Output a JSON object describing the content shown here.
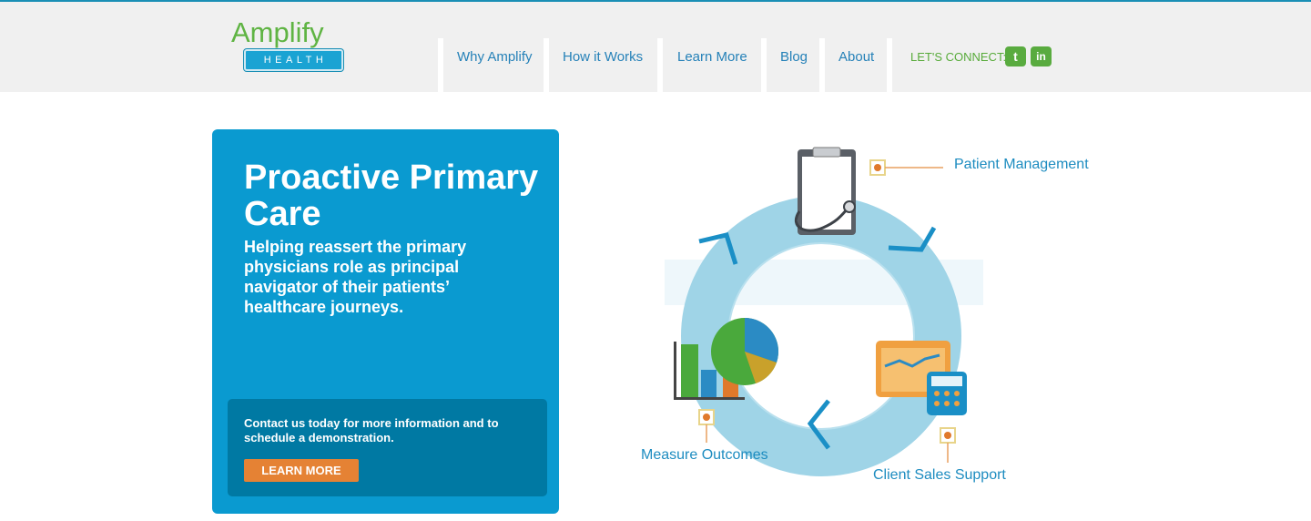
{
  "brand": {
    "name": "Amplify",
    "sub": "HEALTH"
  },
  "nav": {
    "items": [
      {
        "label": "Why Amplify"
      },
      {
        "label": "How it Works"
      },
      {
        "label": "Learn More"
      },
      {
        "label": "Blog"
      },
      {
        "label": "About"
      }
    ],
    "connect_label": "LET'S CONNECT:",
    "social": [
      {
        "name": "twitter-icon",
        "glyph": "t"
      },
      {
        "name": "linkedin-icon",
        "glyph": "in"
      }
    ]
  },
  "hero": {
    "title": "Proactive Primary Care",
    "subtitle": "Helping reassert the primary physicians role as principal navigator of their patients’ healthcare journeys.",
    "cta_text": "Contact us today for more information and to schedule a demonstration.",
    "cta_button": "LEARN MORE"
  },
  "diagram": {
    "labels": {
      "patient": "Patient Management",
      "measure": "Measure Outcomes",
      "sales": "Client Sales Support"
    },
    "icons": [
      "clipboard-stethoscope-icon",
      "bar-pie-chart-icon",
      "calendar-calculator-icon"
    ]
  },
  "colors": {
    "brand_green": "#5fb443",
    "brand_blue": "#0a9ad0",
    "cta_orange": "#e58234",
    "ring": "#9fd4e7"
  }
}
